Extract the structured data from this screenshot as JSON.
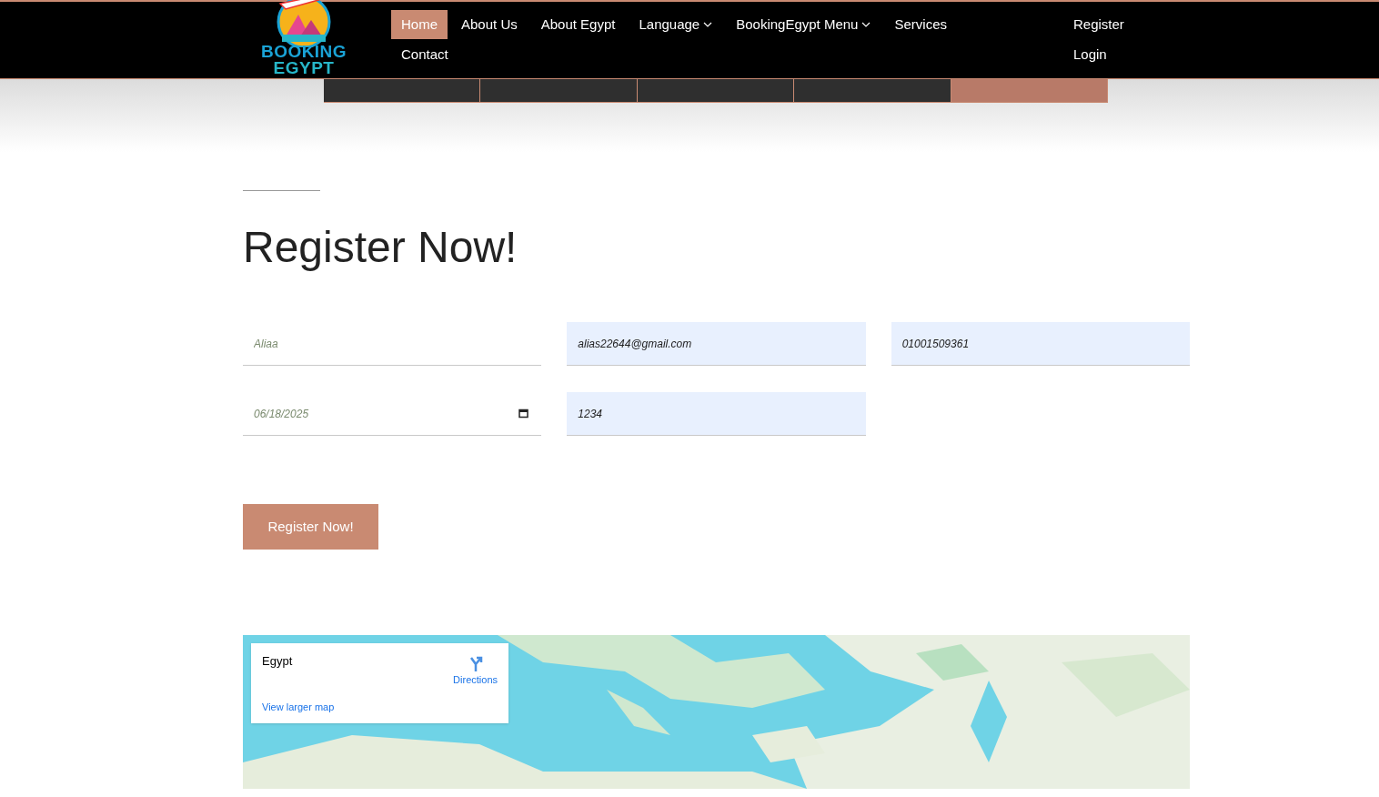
{
  "logo": {
    "line_1": "BOOKING",
    "line_2": "EGYPT"
  },
  "nav": {
    "items": [
      {
        "label": "Home",
        "selected": true,
        "dropdown": false
      },
      {
        "label": "About Us",
        "selected": false,
        "dropdown": false
      },
      {
        "label": "About Egypt",
        "selected": false,
        "dropdown": false
      },
      {
        "label": "Language",
        "selected": false,
        "dropdown": true
      },
      {
        "label": "BookingEgypt Menu",
        "selected": false,
        "dropdown": true
      },
      {
        "label": "Services",
        "selected": false,
        "dropdown": false
      },
      {
        "label": "Contact",
        "selected": false,
        "dropdown": false
      }
    ],
    "account": [
      "Register",
      "Login"
    ]
  },
  "strip": [
    {
      "selected": false
    },
    {
      "selected": false
    },
    {
      "selected": false
    },
    {
      "selected": false
    },
    {
      "selected": true
    }
  ],
  "heading": "Register Now!",
  "fields": [
    {
      "kind": "text",
      "placeholder": "Aliaa",
      "autofilled": false
    },
    {
      "kind": "text",
      "value": "alias22644@gmail.com",
      "autofilled": true
    },
    {
      "kind": "text",
      "value": "01001509361",
      "autofilled": true
    },
    {
      "kind": "date",
      "placeholder": "06/18/2025",
      "autofilled": false
    },
    {
      "kind": "text",
      "value": "1234",
      "autofilled": true
    }
  ],
  "submit": "Register Now!",
  "map": {
    "card": {
      "place": "Egypt",
      "directions": "Directions",
      "larger_map": "View larger map"
    }
  }
}
